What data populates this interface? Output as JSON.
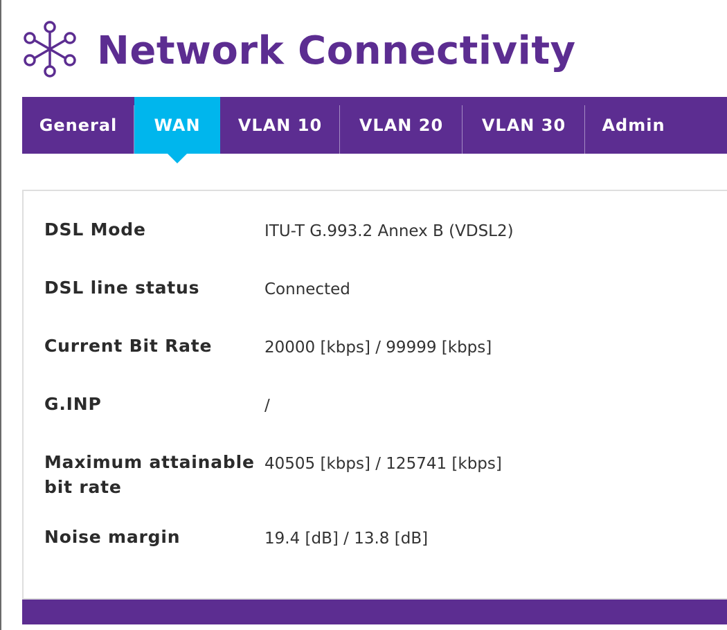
{
  "header": {
    "title": "Network Connectivity",
    "logo_icon": "network-nodes-icon"
  },
  "tabs": [
    {
      "label": "General",
      "active": false
    },
    {
      "label": "WAN",
      "active": true
    },
    {
      "label": "VLAN 10",
      "active": false
    },
    {
      "label": "VLAN 20",
      "active": false
    },
    {
      "label": "VLAN 30",
      "active": false
    },
    {
      "label": "Admin",
      "active": false
    }
  ],
  "wan": {
    "rows": [
      {
        "label": "DSL Mode",
        "value": "ITU-T G.993.2 Annex B (VDSL2)"
      },
      {
        "label": "DSL line status",
        "value": "Connected"
      },
      {
        "label": "Current Bit Rate",
        "value": "20000 [kbps] / 99999 [kbps]"
      },
      {
        "label": "G.INP",
        "value": "/"
      },
      {
        "label": "Maximum attainable bit rate",
        "value": "40505 [kbps] / 125741 [kbps]"
      },
      {
        "label": "Noise margin",
        "value": "19.4 [dB] / 13.8 [dB]"
      }
    ]
  },
  "colors": {
    "brand_purple": "#5c2d91",
    "active_tab": "#00b6ed"
  }
}
